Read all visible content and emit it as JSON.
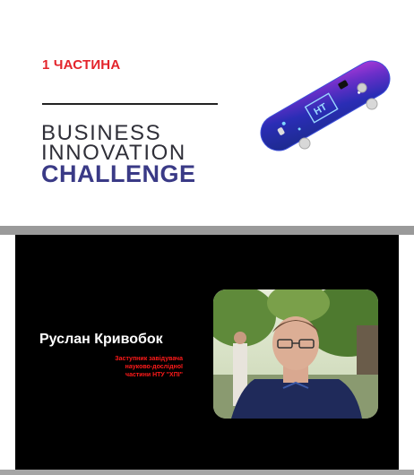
{
  "part_label": "1 ЧАСТИНА",
  "title": {
    "line1": "BUSINESS",
    "line2": "INNOVATION",
    "line3": "CHALLENGE"
  },
  "skateboard": {
    "icon": "skateboard-illustration",
    "deck_text": "НТ"
  },
  "speaker": {
    "name": "Руслан Кривобок",
    "role_line1": "Заступник завідувача",
    "role_line2": "науково-дослідної",
    "role_line3": "частини НТУ \"ХПІ\"",
    "photo": "speaker-photo"
  },
  "colors": {
    "accent_red": "#e3242b",
    "challenge_blue": "#3a3a86",
    "dark_panel": "#000000",
    "band_gray": "#9a9a9a"
  }
}
